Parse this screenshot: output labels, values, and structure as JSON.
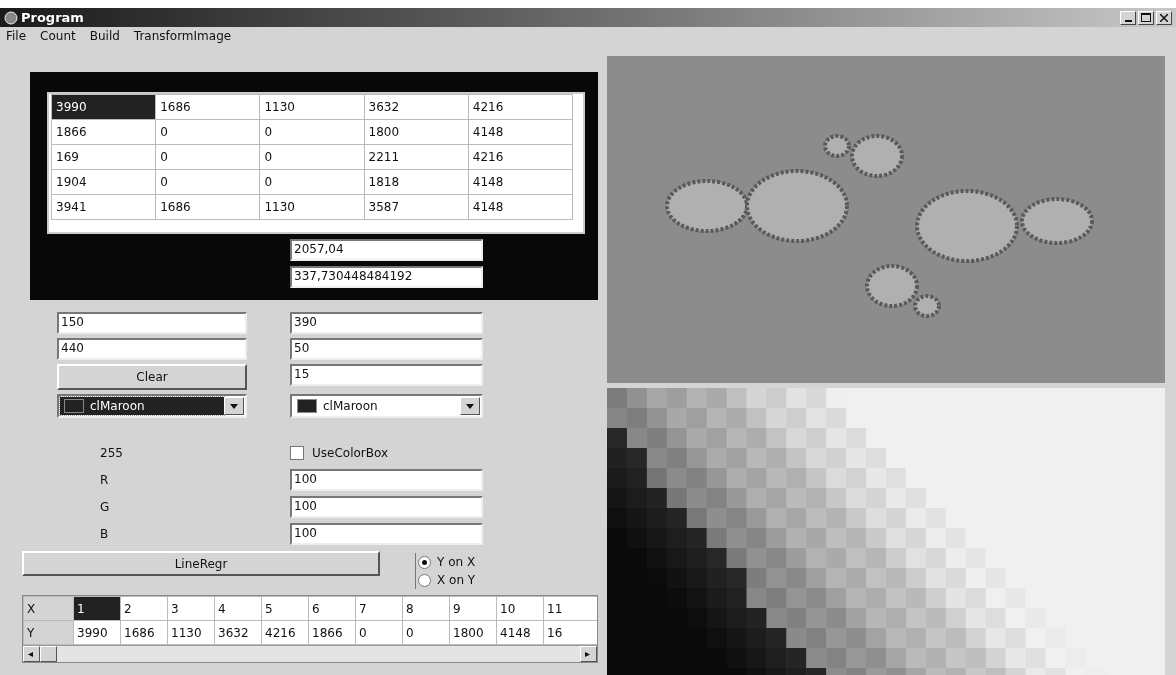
{
  "window": {
    "title": "Program"
  },
  "menu": [
    "File",
    "Count",
    "Build",
    "TransformImage"
  ],
  "top_grid": [
    [
      {
        "text": "3990",
        "selected": true
      },
      {
        "text": "1686",
        "selected": false
      },
      {
        "text": "1130",
        "selected": false
      },
      {
        "text": "3632",
        "selected": false
      },
      {
        "text": "4216",
        "selected": false
      }
    ],
    [
      {
        "text": "1866",
        "selected": false
      },
      {
        "text": "0",
        "selected": false
      },
      {
        "text": "0",
        "selected": false
      },
      {
        "text": "1800",
        "selected": false
      },
      {
        "text": "4148",
        "selected": false
      }
    ],
    [
      {
        "text": "169",
        "selected": false
      },
      {
        "text": "0",
        "selected": false
      },
      {
        "text": "0",
        "selected": false
      },
      {
        "text": "2211",
        "selected": false
      },
      {
        "text": "4216",
        "selected": false
      }
    ],
    [
      {
        "text": "1904",
        "selected": false
      },
      {
        "text": "0",
        "selected": false
      },
      {
        "text": "0",
        "selected": false
      },
      {
        "text": "1818",
        "selected": false
      },
      {
        "text": "4148",
        "selected": false
      }
    ],
    [
      {
        "text": "3941",
        "selected": false
      },
      {
        "text": "1686",
        "selected": false
      },
      {
        "text": "1130",
        "selected": false
      },
      {
        "text": "3587",
        "selected": false
      },
      {
        "text": "4148",
        "selected": false
      }
    ]
  ],
  "results": [
    "2057,04",
    "337,730448484192"
  ],
  "left_fields": [
    "150",
    "440"
  ],
  "right_fields": [
    "390",
    "50",
    "15"
  ],
  "clear_button": "Clear",
  "combos": [
    {
      "value": "clMaroon",
      "focused": true
    },
    {
      "value": "clMaroon",
      "focused": false
    }
  ],
  "value_label": "255",
  "checkbox": {
    "label": "UseColorBox",
    "checked": false
  },
  "rgb": [
    {
      "label": "R",
      "value": "100"
    },
    {
      "label": "G",
      "value": "100"
    },
    {
      "label": "B",
      "value": "100"
    }
  ],
  "regr_button": "LineRegr",
  "radios": [
    {
      "label": "Y on X",
      "selected": true
    },
    {
      "label": "X on Y",
      "selected": false
    }
  ],
  "bottom_grid": [
    {
      "header": "X",
      "cells": [
        {
          "text": "1",
          "selected": true
        },
        {
          "text": "2",
          "selected": false
        },
        {
          "text": "3",
          "selected": false
        },
        {
          "text": "4",
          "selected": false
        },
        {
          "text": "5",
          "selected": false
        },
        {
          "text": "6",
          "selected": false
        },
        {
          "text": "7",
          "selected": false
        },
        {
          "text": "8",
          "selected": false
        },
        {
          "text": "9",
          "selected": false
        },
        {
          "text": "10",
          "selected": false
        },
        {
          "text": "11",
          "selected": false
        }
      ]
    },
    {
      "header": "Y",
      "cells": [
        {
          "text": "3990",
          "selected": false
        },
        {
          "text": "1686",
          "selected": false
        },
        {
          "text": "1130",
          "selected": false
        },
        {
          "text": "3632",
          "selected": false
        },
        {
          "text": "4216",
          "selected": false
        },
        {
          "text": "1866",
          "selected": false
        },
        {
          "text": "0",
          "selected": false
        },
        {
          "text": "0",
          "selected": false
        },
        {
          "text": "1800",
          "selected": false
        },
        {
          "text": "4148",
          "selected": false
        },
        {
          "text": "16",
          "selected": false
        }
      ]
    }
  ]
}
